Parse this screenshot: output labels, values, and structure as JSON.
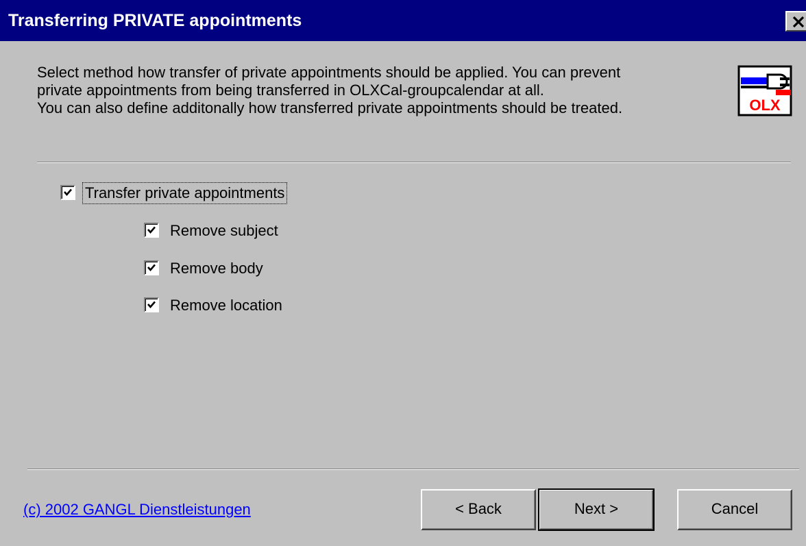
{
  "window": {
    "title": "Transferring PRIVATE appointments",
    "close_glyph": "✕"
  },
  "description": {
    "line1": "Select method how transfer of private appointments should be applied. You can prevent",
    "line2": "private appointments from being transferred in OLXCal-groupcalendar at all.",
    "line3": "You can also define additonally how transferred private appointments should be treated."
  },
  "icon": {
    "name": "olx-app-icon",
    "text": "OLX"
  },
  "options": {
    "transfer_private": {
      "label": "Transfer private appointments",
      "checked": true
    },
    "remove_subject": {
      "label": "Remove subject",
      "checked": true
    },
    "remove_body": {
      "label": "Remove body",
      "checked": true
    },
    "remove_location": {
      "label": "Remove location",
      "checked": true
    }
  },
  "footer": {
    "copyright": "(c) 2002 GANGL Dienstleistungen",
    "back_label": "< Back",
    "next_label": "Next >",
    "cancel_label": "Cancel"
  },
  "colors": {
    "titlebar": "#000080",
    "background": "#c0c0c0",
    "link": "#0000ff"
  }
}
